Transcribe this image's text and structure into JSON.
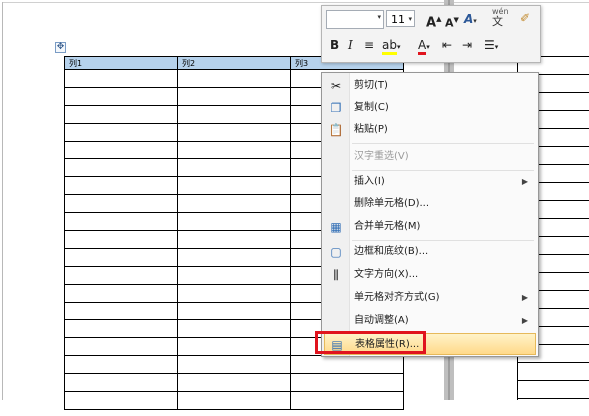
{
  "table": {
    "headers": [
      "列1",
      "列2",
      "列3"
    ],
    "row_count": 19
  },
  "mini_toolbar": {
    "font_name": "",
    "font_size": "11",
    "grow_font": "A",
    "shrink_font": "A",
    "bold": "B",
    "italic": "I",
    "phonetic_label": "wén"
  },
  "context_menu": {
    "items": [
      {
        "label": "剪切(T)",
        "icon": "scissors-icon"
      },
      {
        "label": "复制(C)",
        "icon": "copy-icon"
      },
      {
        "label": "粘贴(P)",
        "icon": "paste-icon"
      },
      {
        "label": "汉字重选(V)",
        "disabled": true
      },
      {
        "label": "插入(I)",
        "submenu": true
      },
      {
        "label": "删除单元格(D)..."
      },
      {
        "label": "合并单元格(M)",
        "icon": "merge-cells-icon"
      },
      {
        "label": "边框和底纹(B)...",
        "icon": "border-icon"
      },
      {
        "label": "文字方向(X)...",
        "icon": "text-direction-icon"
      },
      {
        "label": "单元格对齐方式(G)",
        "submenu": true
      },
      {
        "label": "自动调整(A)",
        "submenu": true
      },
      {
        "label": "表格属性(R)...",
        "icon": "table-properties-icon",
        "highlighted": true
      }
    ]
  },
  "colors": {
    "header_fill": "#b6d2ec",
    "highlight": "#ffd98a",
    "annotation_red": "#e0141e"
  }
}
